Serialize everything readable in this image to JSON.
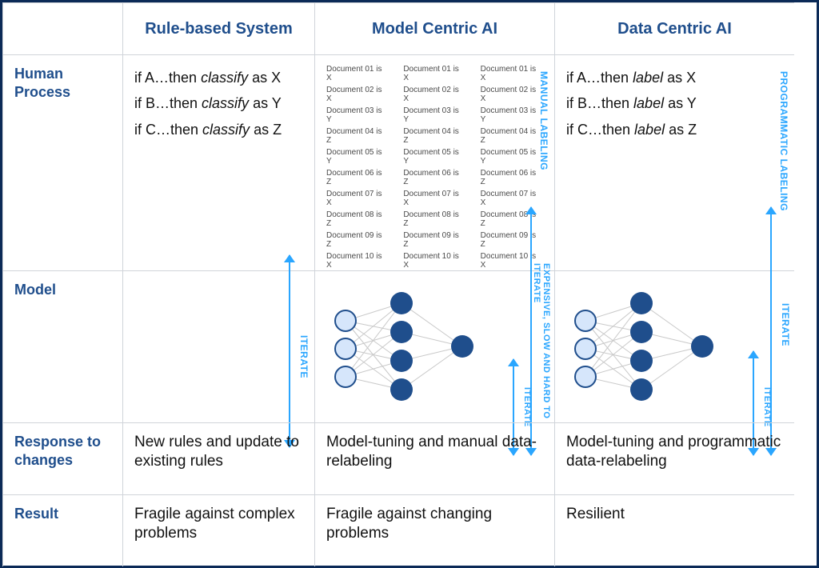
{
  "columns": {
    "c1": "Rule-based System",
    "c2": "Model Centric AI",
    "c3": "Data Centric AI"
  },
  "rows": {
    "r1": "Human Process",
    "r2": "Model",
    "r3": "Response to changes",
    "r4": "Result"
  },
  "rules_classify": [
    {
      "pre": "if A…then ",
      "act": "classify",
      "post": " as X"
    },
    {
      "pre": "if B…then ",
      "act": "classify",
      "post": " as Y"
    },
    {
      "pre": "if C…then ",
      "act": "classify",
      "post": " as Z"
    }
  ],
  "rules_label": [
    {
      "pre": "if A…then ",
      "act": "label",
      "post": " as X"
    },
    {
      "pre": "if B…then ",
      "act": "label",
      "post": " as Y"
    },
    {
      "pre": "if C…then ",
      "act": "label",
      "post": " as Z"
    }
  ],
  "doc_rows": [
    "Document 01 is X",
    "Document 02 is X",
    "Document 03 is Y",
    "Document 04 is Z",
    "Document 05 is Y",
    "Document 06 is Z",
    "Document 07 is X",
    "Document 08 is Z",
    "Document 09 is Z",
    "Document 10 is X"
  ],
  "vlabels": {
    "manual": "MANUAL LABELING",
    "expensive": "EXPENSIVE, SLOW AND HARD TO ITERATE",
    "iterate": "ITERATE",
    "programmatic": "PROGRAMMATIC LABELING"
  },
  "responses": {
    "c1": "New rules and update to existing rules",
    "c2": "Model-tuning and manual data-relabeling",
    "c3": "Model-tuning and programmatic data-relabeling"
  },
  "results": {
    "c1": "Fragile against complex problems",
    "c2": "Fragile against changing problems",
    "c3": "Resilient"
  }
}
